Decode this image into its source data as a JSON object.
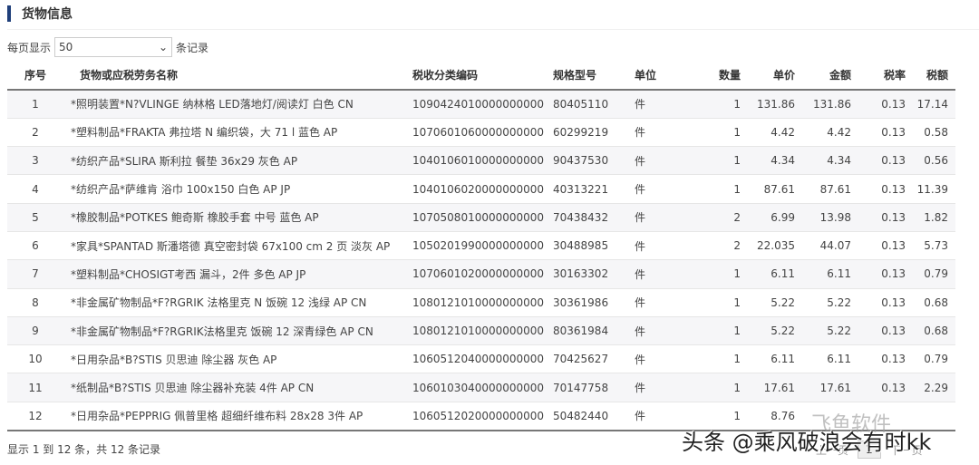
{
  "title": "货物信息",
  "length": {
    "prefix": "每页显示",
    "value": "50",
    "suffix": "条记录"
  },
  "columns": [
    "序号",
    "货物或应税劳务名称",
    "税收分类编码",
    "规格型号",
    "单位",
    "数量",
    "单价",
    "金额",
    "税率",
    "税额"
  ],
  "rows": [
    [
      "1",
      "*照明装置*N?VLINGE 纳林格 LED落地灯/阅读灯 白色 CN",
      "1090424010000000000",
      "80405110",
      "件",
      "1",
      "131.86",
      "131.86",
      "0.13",
      "17.14"
    ],
    [
      "2",
      "*塑料制品*FRAKTA 弗拉塔 N 编织袋，大 71 l 蓝色 AP",
      "1070601060000000000",
      "60299219",
      "件",
      "1",
      "4.42",
      "4.42",
      "0.13",
      "0.58"
    ],
    [
      "3",
      "*纺织产品*SLIRA 斯利拉 餐垫 36x29 灰色 AP",
      "1040106010000000000",
      "90437530",
      "件",
      "1",
      "4.34",
      "4.34",
      "0.13",
      "0.56"
    ],
    [
      "4",
      "*纺织产品*萨维肯 浴巾 100x150 白色 AP JP",
      "1040106020000000000",
      "40313221",
      "件",
      "1",
      "87.61",
      "87.61",
      "0.13",
      "11.39"
    ],
    [
      "5",
      "*橡胶制品*POTKES 鲍奇斯 橡胶手套 中号 蓝色 AP",
      "1070508010000000000",
      "70438432",
      "件",
      "2",
      "6.99",
      "13.98",
      "0.13",
      "1.82"
    ],
    [
      "6",
      "*家具*SPANTAD 斯潘塔德 真空密封袋 67x100 cm 2 页 淡灰 AP",
      "1050201990000000000",
      "30488985",
      "件",
      "2",
      "22.035",
      "44.07",
      "0.13",
      "5.73"
    ],
    [
      "7",
      "*塑料制品*CHOSIGT考西 漏斗，2件 多色 AP JP",
      "1070601020000000000",
      "30163302",
      "件",
      "1",
      "6.11",
      "6.11",
      "0.13",
      "0.79"
    ],
    [
      "8",
      "*非金属矿物制品*F?RGRIK 法格里克 N 饭碗 12 浅绿 AP CN",
      "1080121010000000000",
      "30361986",
      "件",
      "1",
      "5.22",
      "5.22",
      "0.13",
      "0.68"
    ],
    [
      "9",
      "*非金属矿物制品*F?RGRIK法格里克 饭碗 12 深青绿色 AP CN",
      "1080121010000000000",
      "80361984",
      "件",
      "1",
      "5.22",
      "5.22",
      "0.13",
      "0.68"
    ],
    [
      "10",
      "*日用杂品*B?STIS 贝思迪 除尘器 灰色 AP",
      "1060512040000000000",
      "70425627",
      "件",
      "1",
      "6.11",
      "6.11",
      "0.13",
      "0.79"
    ],
    [
      "11",
      "*纸制品*B?STIS 贝思迪 除尘器补充装 4件 AP CN",
      "1060103040000000000",
      "70147758",
      "件",
      "1",
      "17.61",
      "17.61",
      "0.13",
      "2.29"
    ],
    [
      "12",
      "*日用杂品*PEPPRIG 佩普里格 超细纤维布料 28x28 3件 AP",
      "1060512020000000000",
      "50482440",
      "件",
      "1",
      "8.76",
      "",
      "",
      ""
    ]
  ],
  "info": "显示 1 到 12 条，共 12 条记录",
  "pager": {
    "prev": "上一页",
    "current": "1",
    "next": "下一页"
  },
  "watermark": {
    "logo": "飞鱼软件",
    "credit": "头条 @乘风破浪会有时kk"
  }
}
